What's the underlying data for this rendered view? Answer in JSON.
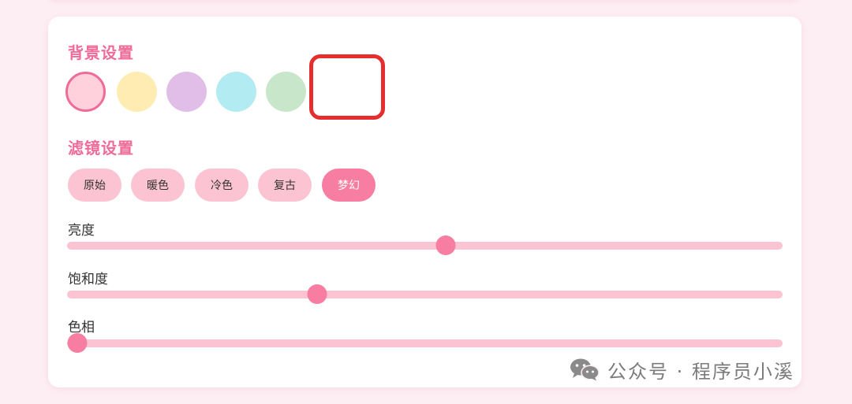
{
  "background_settings": {
    "title": "背景设置",
    "swatches": [
      {
        "color": "#ffd1dc",
        "selected": true
      },
      {
        "color": "#ffecb3"
      },
      {
        "color": "#e1bee7"
      },
      {
        "color": "#b2ebf2"
      },
      {
        "color": "#c8e6c9"
      },
      {
        "color": "#ffffff"
      }
    ]
  },
  "filter_settings": {
    "title": "滤镜设置",
    "options": [
      "原始",
      "暖色",
      "冷色",
      "复古",
      "梦幻"
    ],
    "active": "梦幻"
  },
  "sliders": [
    {
      "label": "亮度",
      "value": 0.53
    },
    {
      "label": "饱和度",
      "value": 0.345
    },
    {
      "label": "色相",
      "value": 0.0
    }
  ],
  "watermark": {
    "text": "公众号 · 程序员小溪",
    "icon": "wechat-icon"
  },
  "colors": {
    "accent": "#ef6b98",
    "active_pink": "#f77ea2",
    "soft_pink": "#fcc3d2",
    "highlight": "#e62e2e"
  }
}
